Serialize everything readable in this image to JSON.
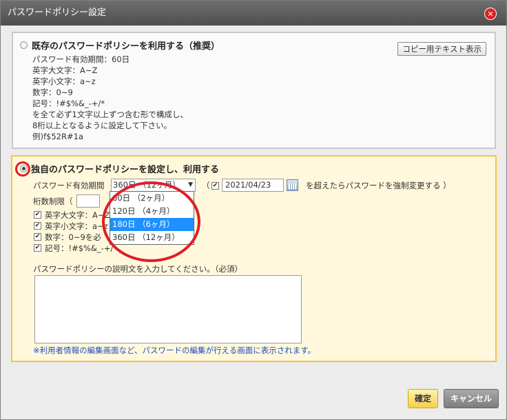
{
  "dialog": {
    "title": "パスワードポリシー設定",
    "close_icon": "close-icon"
  },
  "existing": {
    "heading": "既存のパスワードポリシーを利用する（推奨）",
    "copy_button": "コピー用テキスト表示",
    "lines": [
      "パスワード有効期間：60日",
      "英字大文字：A~Z",
      "英字小文字：a~z",
      "数字：0~9",
      "記号：!#$%&_-+/*",
      "を全て必ず1文字以上ずつ含む形で構成し、",
      "8桁以上となるように設定して下さい。",
      "例)f$52R#1a"
    ]
  },
  "custom": {
    "heading": "独自のパスワードポリシーを設定し、利用する",
    "validity_label": "パスワード有効期間",
    "validity_selected": "360日 （12ヶ月）",
    "paren_open": "（",
    "date_value": "2021/04/23",
    "force_change_text": "を超えたらパスワードを強制変更する ）",
    "digits_label": "桁数制限（",
    "checkbox_labels": [
      "英字大文字：A~Z",
      "英字小文字：a~z",
      "数字：0~9を必",
      "記号：!#$%&_-+/"
    ],
    "desc_label": "パスワードポリシーの説明文を入力してください。（必須）",
    "note": "※利用者情報の編集画面など、パスワードの編集が行える画面に表示されます。",
    "dropdown_options": [
      "60日 （2ヶ月）",
      "120日 （4ヶ月）",
      "180日 （6ヶ月）",
      "360日 （12ヶ月）"
    ],
    "dropdown_highlighted_index": 2
  },
  "footer": {
    "ok": "確定",
    "cancel": "キャンセル"
  },
  "colors": {
    "highlight": "#1e90ff",
    "annotation_red": "#e01d2a",
    "custom_panel_border": "#f5c242"
  }
}
